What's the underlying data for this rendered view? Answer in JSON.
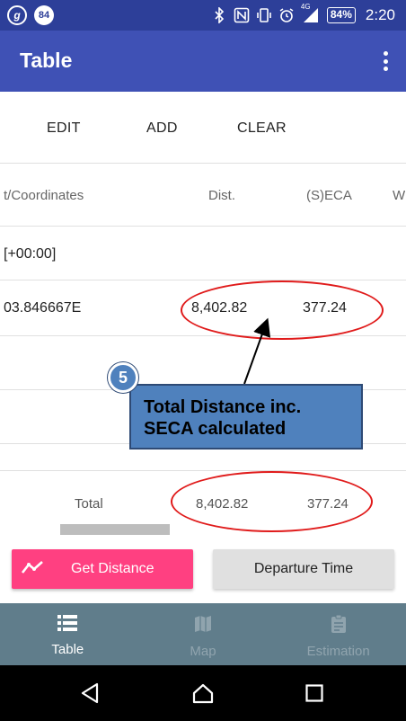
{
  "status_bar": {
    "badge_g": "g",
    "badge_count": "84",
    "network": "4G",
    "battery": "84%",
    "time": "2:20"
  },
  "app_bar": {
    "title": "Table"
  },
  "toolbar": {
    "edit": "EDIT",
    "add": "ADD",
    "clear": "CLEAR"
  },
  "table": {
    "headers": {
      "coords": "t/Coordinates",
      "dist": "Dist.",
      "seca": "(S)ECA",
      "w": "W"
    },
    "row1": {
      "coords": "[+00:00]"
    },
    "row2": {
      "coords": "03.846667E",
      "dist": "8,402.82",
      "seca": "377.24"
    },
    "total": {
      "label": "Total",
      "dist": "8,402.82",
      "seca": "377.24"
    }
  },
  "annotation": {
    "step": "5",
    "line1": "Total Distance inc.",
    "line2": "SECA calculated"
  },
  "actions": {
    "get_distance": "Get Distance",
    "departure_time": "Departure Time"
  },
  "bottom_nav": [
    {
      "label": "Table",
      "icon": "list-icon"
    },
    {
      "label": "Map",
      "icon": "map-icon"
    },
    {
      "label": "Estimation",
      "icon": "clipboard-icon"
    }
  ],
  "colors": {
    "app_bar": "#3f51b5",
    "status_bar": "#2d3f99",
    "accent": "#ff4081",
    "nav_bg": "#607d8b",
    "annotation": "#e01b1b",
    "callout": "#4f81bd"
  }
}
